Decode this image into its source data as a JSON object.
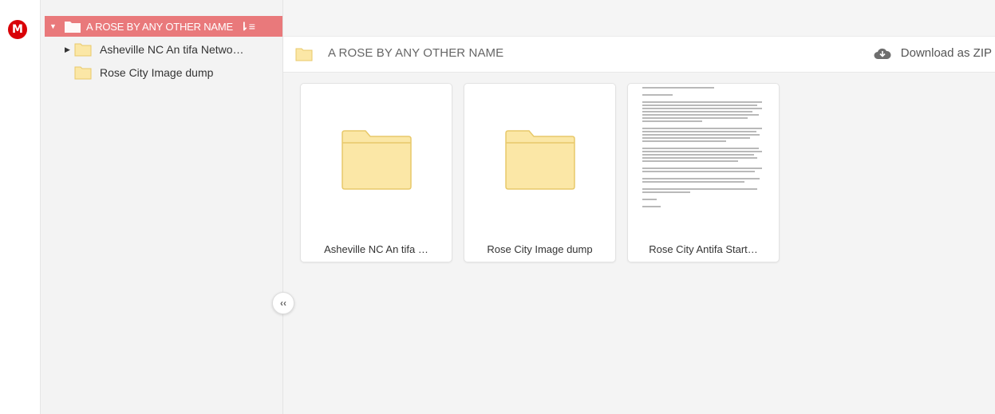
{
  "brand": {
    "logo_letter": "M",
    "color": "#d90007"
  },
  "sidebar": {
    "root": {
      "label": "A ROSE BY ANY OTHER NAME",
      "color": "#e9797b",
      "sort_icon": "sort-icon"
    },
    "items": [
      {
        "label": "Asheville NC An tifa Netwo…",
        "expandable": true
      },
      {
        "label": "Rose City Image dump",
        "expandable": false
      }
    ],
    "collapse_label": "‹‹"
  },
  "header": {
    "title": "A ROSE BY ANY OTHER NAME",
    "download_label": "Download as ZIP"
  },
  "files": [
    {
      "name": "Asheville NC An tifa …",
      "type": "folder"
    },
    {
      "name": "Rose City Image dump",
      "type": "folder"
    },
    {
      "name": "Rose City Antifa Start…",
      "type": "document"
    }
  ],
  "colors": {
    "folder_fill": "#fbe7a6",
    "folder_stroke": "#e8c96a",
    "accent": "#e9797b"
  }
}
